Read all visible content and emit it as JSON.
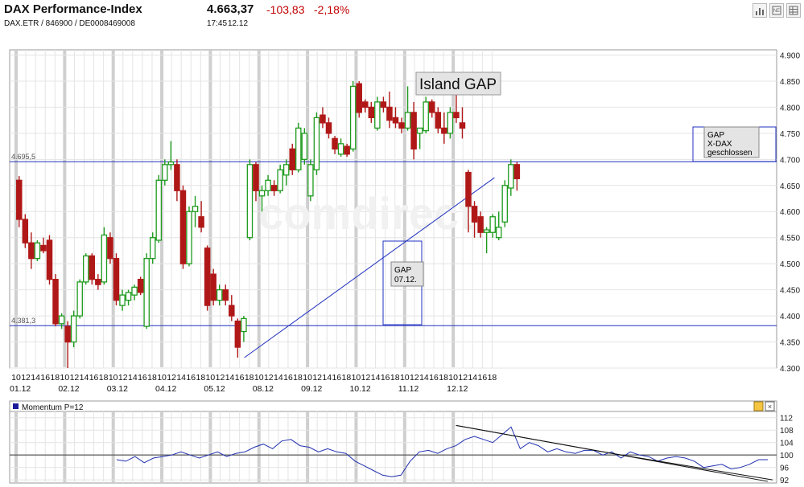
{
  "header": {
    "title": "DAX Performance-Index",
    "price": "4.663,37",
    "change": "-103,83",
    "change_pct": "-2,18%",
    "subtitle": "DAX.ETR / 846900 / DE0008469008",
    "time": "17:45",
    "date": "12.12",
    "toolbar_icons": [
      "bar-chart-icon",
      "news-icon",
      "table-icon"
    ],
    "down_color": "#c00000"
  },
  "colors": {
    "up": "#1e9b1e",
    "down": "#b01818",
    "line": "#2030c0",
    "grid": "#e4e4e4",
    "session": "#cfcfcf"
  },
  "chart_data": [
    {
      "type": "candlestick",
      "title": "",
      "x_tick_labels": [
        "10",
        "12",
        "14",
        "16",
        "18",
        "10",
        "12",
        "14",
        "16",
        "18",
        "10",
        "12",
        "14",
        "16",
        "18",
        "10",
        "12",
        "14",
        "16",
        "18",
        "10",
        "12",
        "14",
        "16",
        "18",
        "10",
        "12",
        "14",
        "16",
        "18",
        "10",
        "12",
        "14",
        "16",
        "18",
        "10",
        "12",
        "14",
        "16",
        "18",
        "10",
        "12",
        "14",
        "16",
        "18",
        "10",
        "12",
        "14",
        "16",
        "18"
      ],
      "days": [
        "01.12",
        "02.12",
        "03.12",
        "04.12",
        "05.12",
        "08.12",
        "09.12",
        "10.12",
        "11.12",
        "12.12"
      ],
      "yticks": [
        4300,
        4350,
        4400,
        4450,
        4500,
        4550,
        4600,
        4650,
        4700,
        4750,
        4800,
        4850,
        4900
      ],
      "ytick_labels": [
        "4.300",
        "4.350",
        "4.400",
        "4.450",
        "4.500",
        "4.550",
        "4.600",
        "4.650",
        "4.700",
        "4.750",
        "4.800",
        "4.850",
        "4.900"
      ],
      "ylim": [
        4300,
        4910
      ],
      "hlines": [
        {
          "value": 4695.5,
          "label": "4.695,5"
        },
        {
          "value": 4381.3,
          "label": "4.381,3"
        }
      ],
      "trendline": {
        "from": {
          "day": "05.12",
          "hour": 17,
          "price": 4320
        },
        "to": {
          "day": "12.12",
          "hour": 18.5,
          "price": 4665
        }
      },
      "annotations": [
        {
          "text": [
            "Island GAP"
          ]
        },
        {
          "text": [
            "GAP",
            "07.12."
          ]
        },
        {
          "text": [
            "GAP",
            "X-DAX",
            "geschlossen"
          ]
        }
      ],
      "watermark": "comdirect",
      "candles": [
        [
          4660,
          4668,
          4570,
          4585
        ],
        [
          4585,
          4595,
          4530,
          4540
        ],
        [
          4540,
          4560,
          4490,
          4510
        ],
        [
          4510,
          4545,
          4505,
          4540
        ],
        [
          4535,
          4550,
          4520,
          4525
        ],
        [
          4545,
          4555,
          4460,
          4470
        ],
        [
          4470,
          4480,
          4380,
          4385
        ],
        [
          4385,
          4405,
          4375,
          4400
        ],
        [
          4380,
          4390,
          4300,
          4350
        ],
        [
          4350,
          4410,
          4340,
          4400
        ],
        [
          4400,
          4470,
          4395,
          4465
        ],
        [
          4465,
          4520,
          4460,
          4515
        ],
        [
          4515,
          4520,
          4460,
          4470
        ],
        [
          4470,
          4480,
          4450,
          4460
        ],
        [
          4465,
          4570,
          4460,
          4555
        ],
        [
          4550,
          4560,
          4500,
          4510
        ],
        [
          4510,
          4520,
          4420,
          4430
        ],
        [
          4420,
          4450,
          4410,
          4440
        ],
        [
          4430,
          4450,
          4420,
          4445
        ],
        [
          4440,
          4460,
          4430,
          4455
        ],
        [
          4470,
          4475,
          4440,
          4445
        ],
        [
          4380,
          4520,
          4375,
          4510
        ],
        [
          4510,
          4560,
          4500,
          4550
        ],
        [
          4545,
          4670,
          4540,
          4660
        ],
        [
          4660,
          4700,
          4650,
          4690
        ],
        [
          4690,
          4735,
          4680,
          4695
        ],
        [
          4690,
          4700,
          4620,
          4640
        ],
        [
          4640,
          4650,
          4490,
          4500
        ],
        [
          4500,
          4610,
          4495,
          4600
        ],
        [
          4600,
          4630,
          4570,
          4610
        ],
        [
          4590,
          4620,
          4560,
          4570
        ],
        [
          4530,
          4535,
          4410,
          4420
        ],
        [
          4480,
          4490,
          4420,
          4430
        ],
        [
          4430,
          4460,
          4420,
          4450
        ],
        [
          4450,
          4460,
          4420,
          4430
        ],
        [
          4420,
          4440,
          4390,
          4400
        ],
        [
          4390,
          4395,
          4320,
          4340
        ],
        [
          4370,
          4400,
          4350,
          4395
        ],
        [
          4550,
          4700,
          4545,
          4690
        ],
        [
          4690,
          4695,
          4620,
          4640
        ],
        [
          4630,
          4650,
          4600,
          4640
        ],
        [
          4640,
          4670,
          4630,
          4660
        ],
        [
          4650,
          4660,
          4630,
          4640
        ],
        [
          4640,
          4690,
          4635,
          4680
        ],
        [
          4670,
          4700,
          4650,
          4690
        ],
        [
          4720,
          4730,
          4670,
          4680
        ],
        [
          4680,
          4770,
          4675,
          4760
        ],
        [
          4700,
          4760,
          4690,
          4750
        ],
        [
          4630,
          4700,
          4620,
          4690
        ],
        [
          4680,
          4790,
          4670,
          4780
        ],
        [
          4785,
          4800,
          4760,
          4770
        ],
        [
          4770,
          4780,
          4740,
          4750
        ],
        [
          4740,
          4745,
          4710,
          4720
        ],
        [
          4710,
          4740,
          4705,
          4730
        ],
        [
          4725,
          4730,
          4705,
          4710
        ],
        [
          4720,
          4850,
          4715,
          4840
        ],
        [
          4845,
          4850,
          4780,
          4790
        ],
        [
          4810,
          4815,
          4790,
          4800
        ],
        [
          4800,
          4810,
          4770,
          4780
        ],
        [
          4760,
          4820,
          4755,
          4810
        ],
        [
          4810,
          4820,
          4790,
          4800
        ],
        [
          4800,
          4830,
          4760,
          4775
        ],
        [
          4780,
          4800,
          4760,
          4770
        ],
        [
          4770,
          4780,
          4750,
          4760
        ],
        [
          4760,
          4840,
          4755,
          4790
        ],
        [
          4790,
          4810,
          4700,
          4720
        ],
        [
          4750,
          4760,
          4720,
          4760
        ],
        [
          4755,
          4820,
          4750,
          4810
        ],
        [
          4810,
          4815,
          4780,
          4790
        ],
        [
          4790,
          4800,
          4750,
          4760
        ],
        [
          4760,
          4790,
          4730,
          4750
        ],
        [
          4750,
          4800,
          4740,
          4790
        ],
        [
          4790,
          4825,
          4770,
          4780
        ],
        [
          4770,
          4800,
          4740,
          4760
        ],
        [
          4675,
          4680,
          4560,
          4610
        ],
        [
          4610,
          4620,
          4550,
          4580
        ],
        [
          4590,
          4600,
          4550,
          4560
        ],
        [
          4560,
          4570,
          4520,
          4565
        ],
        [
          4560,
          4595,
          4550,
          4590
        ],
        [
          4550,
          4600,
          4545,
          4570
        ],
        [
          4580,
          4660,
          4570,
          4650
        ],
        [
          4645,
          4700,
          4630,
          4690
        ],
        [
          4690,
          4695,
          4640,
          4663
        ]
      ]
    },
    {
      "type": "line",
      "title": "Momentum P=12",
      "yticks": [
        92,
        96,
        100,
        104,
        108,
        112
      ],
      "ylim": [
        91,
        114
      ],
      "baseline": 100,
      "series": [
        {
          "values": [
            98.5,
            98,
            99.5,
            97.5,
            99,
            99.5,
            100,
            101,
            100,
            99,
            100,
            101,
            99.5,
            100.5,
            101,
            102.5,
            103.5,
            102,
            104.5,
            105,
            103,
            102.5,
            101,
            102,
            101,
            100.5,
            98,
            96.5,
            95,
            93.5,
            93,
            93.5,
            98,
            101,
            101.5,
            100.5,
            102,
            103,
            105,
            106,
            105,
            104,
            106.5,
            109,
            102,
            104,
            103,
            101,
            102,
            101,
            100.5,
            101.5,
            101.5,
            100,
            101,
            99,
            101,
            100,
            99.5,
            98,
            99,
            99.5,
            99,
            98,
            96,
            96.5,
            97,
            95.5,
            96,
            97,
            98.5,
            98.5
          ]
        }
      ],
      "trendline": {
        "from": {
          "index": 37,
          "value": 109.5
        },
        "to": {
          "index": 71,
          "value": 91.5
        }
      },
      "toolbar_icons": [
        "settings-icon",
        "close-icon"
      ]
    }
  ]
}
